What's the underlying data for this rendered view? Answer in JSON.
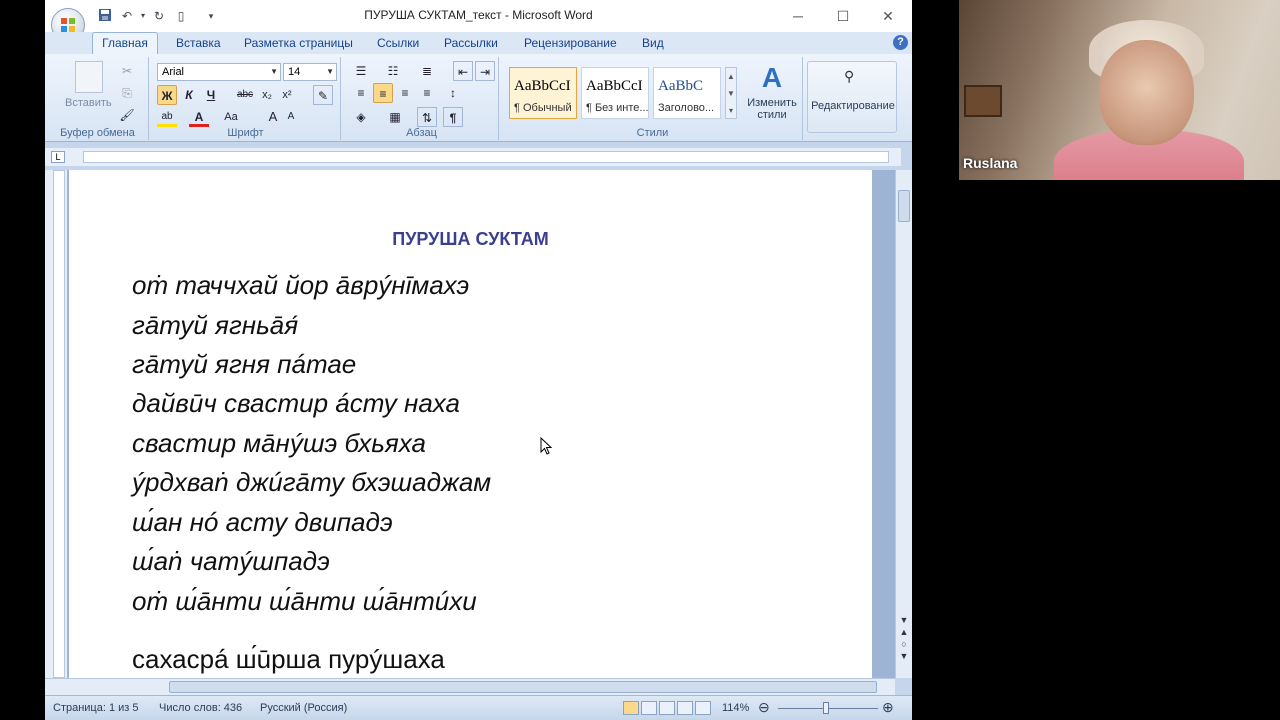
{
  "window": {
    "title": "ПУРУША СУКТАМ_текст - Microsoft Word",
    "minimize": "─",
    "maximize": "☐",
    "close": "✕"
  },
  "tabs": [
    {
      "label": "Главная",
      "active": true
    },
    {
      "label": "Вставка"
    },
    {
      "label": "Разметка страницы"
    },
    {
      "label": "Ссылки"
    },
    {
      "label": "Рассылки"
    },
    {
      "label": "Рецензирование"
    },
    {
      "label": "Вид"
    }
  ],
  "ribbon": {
    "clipboard": {
      "label": "Буфер обмена",
      "paste": "Вставить"
    },
    "font": {
      "label": "Шрифт",
      "font_name": "Arial",
      "font_size": "14"
    },
    "paragraph": {
      "label": "Абзац"
    },
    "styles": {
      "label": "Стили",
      "items": [
        {
          "sample": "AaBbCcI",
          "name": "¶ Обычный"
        },
        {
          "sample": "AaBbCcI",
          "name": "¶ Без инте..."
        },
        {
          "sample": "AaBbC",
          "name": "Заголово..."
        }
      ],
      "change_styles": "Изменить стили"
    },
    "editing": {
      "label": "Редактирование"
    }
  },
  "document": {
    "title": "ПУРУША СУКТАМ",
    "lines": [
      "оṁ таччхай йор āврýнīмахэ",
      "гāтуй ягньāя́",
      "гāтуй ягня пáтае",
      "дайвūч свастир áсту наха",
      "свастир мāнýшэ бхьяха",
      "ýрдхваṅ джúгāту бхэшаджам",
      "ш́ан нó асту двипадэ",
      "ш́аṅ чатýшпадэ",
      "оṁ ш́āнти ш́āнти ш́āнтúхи",
      "сахасрá ш́ūрша пурýшаха"
    ]
  },
  "status": {
    "page": "Страница: 1 из 5",
    "words": "Число слов: 436",
    "language": "Русский (Россия)",
    "zoom": "114%"
  },
  "video": {
    "participant_name": "Ruslana"
  },
  "colors": {
    "highlight": "#ffff00",
    "title_color": "#3a3f8f",
    "ribbon_bg": "#dce7f5"
  }
}
